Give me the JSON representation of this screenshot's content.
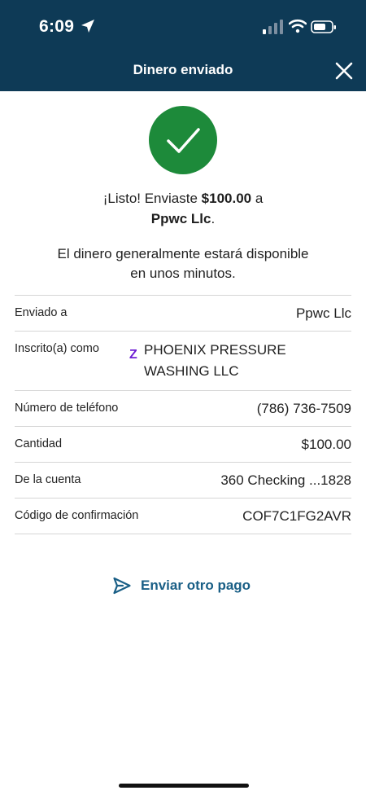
{
  "status_bar": {
    "time": "6:09",
    "icons": [
      "location-arrow-icon",
      "cellular-signal-icon",
      "wifi-icon",
      "battery-icon"
    ]
  },
  "nav": {
    "title": "Dinero enviado",
    "close_icon": "close-icon"
  },
  "colors": {
    "header_bg": "#0e3a56",
    "success_green": "#1d8a3a",
    "link_blue": "#1a5f86",
    "zelle_purple": "#6d1ed4"
  },
  "confirmation": {
    "line1_prefix": "¡Listo! Enviaste ",
    "amount": "$100.00",
    "line1_suffix": " a",
    "recipient": "Ppwc Llc",
    "recipient_suffix": ".",
    "info_line1": "El dinero generalmente estará disponible",
    "info_line2": "en unos minutos."
  },
  "details": {
    "sent_to": {
      "label": "Enviado a",
      "value": "Ppwc Llc"
    },
    "enrolled_as": {
      "label": "Inscrito(a) como",
      "icon": "zelle-icon",
      "icon_text": "Z",
      "value": "PHOENIX PRESSURE WASHING LLC"
    },
    "phone": {
      "label": "Número de teléfono",
      "value": "(786) 736-7509"
    },
    "amount": {
      "label": "Cantidad",
      "value": "$100.00"
    },
    "account": {
      "label": "De la cuenta",
      "value": "360 Checking ...1828"
    },
    "confirmation_code": {
      "label": "Código de confirmación",
      "value": "COF7C1FG2AVR"
    }
  },
  "actions": {
    "send_again_label": "Enviar otro pago",
    "send_again_icon": "paper-plane-icon"
  }
}
